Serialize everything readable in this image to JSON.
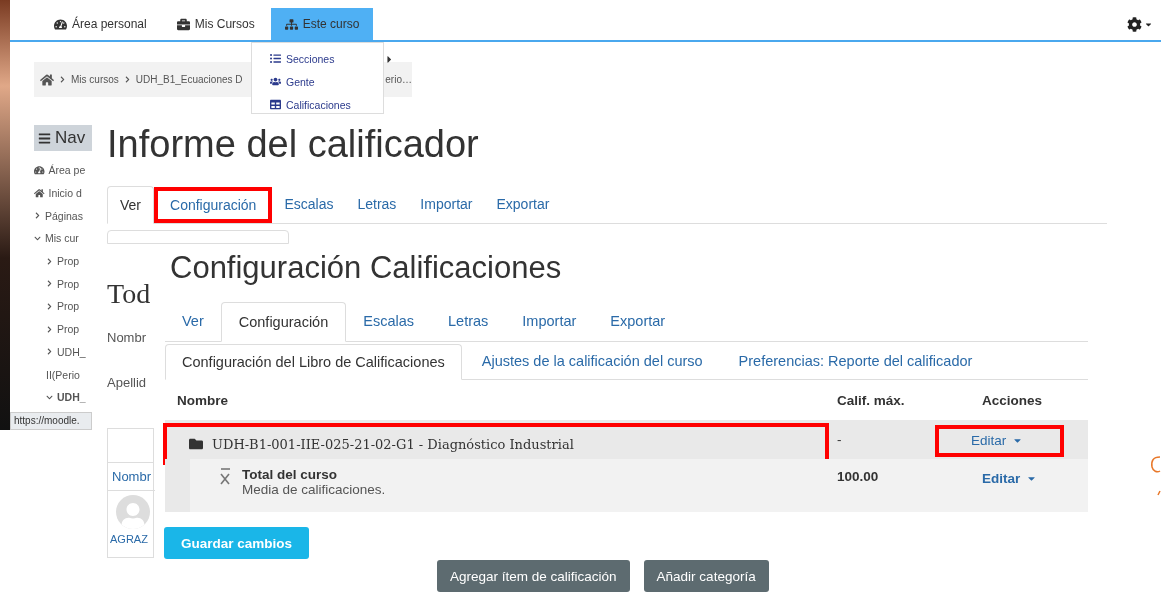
{
  "background_page": {
    "navbar": {
      "items": [
        {
          "label": "Área personal",
          "selected": false
        },
        {
          "label": "Mis Cursos",
          "selected": false
        },
        {
          "label": "Este curso",
          "selected": true
        }
      ]
    },
    "dropdown": {
      "items": [
        "Secciones",
        "Gente",
        "Calificaciones"
      ]
    },
    "breadcrumb": [
      "Mis cursos",
      "UDH_B1_Ecuaciones D",
      "erio…"
    ],
    "sidebar": {
      "button": "Nav",
      "items": [
        {
          "kind": "dashboard",
          "label": "Área pe"
        },
        {
          "kind": "home",
          "label": "Inicio d"
        },
        {
          "kind": "node",
          "label": "Páginas",
          "expanded": false
        },
        {
          "kind": "node",
          "label": "Mis cur",
          "expanded": true,
          "children": [
            {
              "kind": "node",
              "label": "Prop",
              "expanded": false
            },
            {
              "kind": "node",
              "label": "Prop",
              "expanded": false
            },
            {
              "kind": "node",
              "label": "Prop",
              "expanded": false
            },
            {
              "kind": "node",
              "label": "Prop",
              "expanded": false
            },
            {
              "kind": "node",
              "label": "UDH_",
              "continuation": "II(Perio",
              "expanded": false
            },
            {
              "kind": "node",
              "label": "UDH_",
              "expanded": true,
              "current": true
            }
          ]
        }
      ]
    },
    "status_url": "https://moodle."
  },
  "grader_report": {
    "title": "Informe del calificador",
    "tabs": [
      {
        "label": "Ver",
        "selected": true,
        "highlighted": false
      },
      {
        "label": "Configuración",
        "selected": false,
        "highlighted": true
      },
      {
        "label": "Escalas",
        "selected": false,
        "highlighted": false
      },
      {
        "label": "Letras",
        "selected": false,
        "highlighted": false
      },
      {
        "label": "Importar",
        "selected": false,
        "highlighted": false
      },
      {
        "label": "Exportar",
        "selected": false,
        "highlighted": false
      }
    ],
    "heading": "Tod",
    "filters": [
      "Nombr",
      "Apellid"
    ],
    "table": {
      "column_1": "Nombr",
      "rows": [
        "AGRAZ"
      ]
    }
  },
  "gradebook_setup": {
    "title": "Configuración Calificaciones",
    "tabs": [
      {
        "label": "Ver",
        "selected": false
      },
      {
        "label": "Configuración",
        "selected": true
      },
      {
        "label": "Escalas",
        "selected": false
      },
      {
        "label": "Letras",
        "selected": false
      },
      {
        "label": "Importar",
        "selected": false
      },
      {
        "label": "Exportar",
        "selected": false
      }
    ],
    "subtabs": [
      {
        "label": "Configuración del Libro de Calificaciones",
        "selected": true
      },
      {
        "label": "Ajustes de la calificación del curso",
        "selected": false
      },
      {
        "label": "Preferencias: Reporte del calificador",
        "selected": false
      }
    ],
    "table": {
      "columns": [
        "Nombre",
        "Calif. máx.",
        "Acciones"
      ],
      "rows": [
        {
          "kind": "category",
          "name": "UDH-B1-001-IIE-025-21-02-G1 - Diagnóstico Industrial",
          "max": "-",
          "action": "Editar",
          "highlighted": true
        },
        {
          "kind": "total",
          "name": "Total del curso",
          "description": "Media de calificaciones.",
          "max": "100.00",
          "action": "Editar",
          "highlighted": false
        }
      ]
    },
    "save_button": "Guardar cambios",
    "buttons": [
      "Agregar ítem de calificación",
      "Añadir categoría"
    ]
  }
}
